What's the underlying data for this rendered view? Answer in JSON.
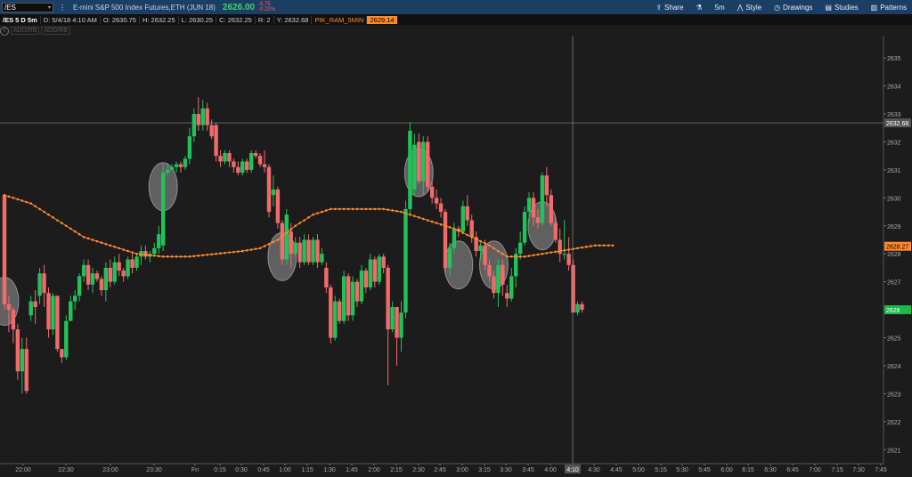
{
  "toolbar": {
    "symbol": "/ES",
    "description": "E-mini S&P 500 Index Futures,ETH (JUN 18)",
    "last_price": "2626.00",
    "net_change": "-5.75",
    "pct_change": "-0.22%",
    "share_label": "Share",
    "style_label": "Style",
    "drawings_label": "Drawings",
    "studies_label": "Studies",
    "patterns_label": "Patterns",
    "interval_icon_label": "5m"
  },
  "infobar": {
    "symbol_period": "/ES 5 D 5m",
    "date": "D: 5/4/18 4:10 AM",
    "open": "O: 2630.75",
    "high": "H: 2632.25",
    "low": "L: 2630.25",
    "close": "C: 2632.25",
    "r": "R: 2",
    "y": "Y: 2632.68",
    "study_name": "PIK_RAM_5MIN",
    "study_value": "2629.14",
    "badge1": "ADD/RB",
    "badge2": "ADD/RB"
  },
  "chart_data": {
    "type": "candlestick",
    "y_axis": {
      "range": [
        2620.5,
        2635.8
      ],
      "tick_labels": [
        "2621",
        "2622",
        "2623",
        "2624",
        "2625",
        "2626",
        "2627",
        "2628",
        "2629",
        "2630",
        "2631",
        "2632",
        "2633",
        "2634",
        "2635"
      ],
      "side": "right"
    },
    "x_axis": {
      "tick_labels": [
        "22:00",
        "22:30",
        "23:00",
        "23:30",
        "Fri",
        "0:15",
        "0:30",
        "0:45",
        "1:00",
        "1:15",
        "1:30",
        "1:45",
        "2:00",
        "2:15",
        "2:30",
        "2:45",
        "3:00",
        "3:15",
        "3:30",
        "3:45",
        "4:00",
        "4:10",
        "4:30",
        "4:45",
        "5:00",
        "5:15",
        "5:30",
        "5:45",
        "6:00",
        "6:15",
        "6:30",
        "6:45",
        "7:00",
        "7:15",
        "7:30",
        "7:45"
      ]
    },
    "candles": [
      [
        2630.1,
        2630.1,
        2626.0,
        2626.2
      ],
      [
        2626.2,
        2626.5,
        2625.2,
        2626.0
      ],
      [
        2626.0,
        2626.1,
        2624.8,
        2625.3
      ],
      [
        2625.3,
        2625.5,
        2623.5,
        2623.8
      ],
      [
        2623.8,
        2625.0,
        2623.0,
        2624.6
      ],
      [
        2624.6,
        2625.0,
        2623.0,
        2623.1
      ],
      [
        2625.8,
        2626.5,
        2625.6,
        2626.3
      ],
      [
        2626.3,
        2626.7,
        2625.5,
        2626.1
      ],
      [
        2626.5,
        2627.5,
        2626.2,
        2627.3
      ],
      [
        2627.3,
        2627.6,
        2626.1,
        2626.6
      ],
      [
        2626.6,
        2626.8,
        2625.0,
        2625.3
      ],
      [
        2625.3,
        2626.6,
        2625.1,
        2626.5
      ],
      [
        2626.5,
        2626.5,
        2624.5,
        2624.6
      ],
      [
        2624.6,
        2624.6,
        2624.1,
        2624.3
      ],
      [
        2624.3,
        2625.8,
        2624.2,
        2625.6
      ],
      [
        2625.6,
        2626.5,
        2625.6,
        2626.3
      ],
      [
        2626.3,
        2626.7,
        2626.0,
        2626.5
      ],
      [
        2626.5,
        2627.3,
        2626.3,
        2627.2
      ],
      [
        2627.2,
        2627.8,
        2627.0,
        2627.6
      ],
      [
        2627.6,
        2627.8,
        2626.7,
        2626.9
      ],
      [
        2626.9,
        2627.5,
        2626.6,
        2627.3
      ],
      [
        2627.3,
        2627.4,
        2627.0,
        2627.1
      ],
      [
        2627.1,
        2627.2,
        2626.5,
        2626.7
      ],
      [
        2626.7,
        2627.7,
        2626.3,
        2627.5
      ],
      [
        2627.5,
        2627.8,
        2626.8,
        2627.0
      ],
      [
        2627.0,
        2627.9,
        2626.9,
        2627.7
      ],
      [
        2627.7,
        2628.0,
        2627.2,
        2627.4
      ],
      [
        2627.4,
        2627.5,
        2627.0,
        2627.2
      ],
      [
        2627.2,
        2627.9,
        2627.1,
        2627.8
      ],
      [
        2627.8,
        2628.0,
        2627.3,
        2627.5
      ],
      [
        2627.5,
        2628.0,
        2627.4,
        2627.9
      ],
      [
        2627.9,
        2628.3,
        2627.6,
        2628.1
      ],
      [
        2628.1,
        2628.3,
        2627.8,
        2627.9
      ],
      [
        2627.9,
        2628.1,
        2627.7,
        2628.0
      ],
      [
        2628.0,
        2628.4,
        2627.9,
        2628.2
      ],
      [
        2628.2,
        2629.0,
        2628.0,
        2628.7
      ],
      [
        2628.3,
        2631.2,
        2628.1,
        2630.9
      ],
      [
        2630.9,
        2631.2,
        2630.8,
        2631.0
      ],
      [
        2631.0,
        2631.2,
        2631.0,
        2631.1
      ],
      [
        2631.1,
        2631.3,
        2630.9,
        2631.2
      ],
      [
        2631.2,
        2631.3,
        2630.9,
        2631.1
      ],
      [
        2631.1,
        2631.5,
        2631.0,
        2631.4
      ],
      [
        2631.4,
        2632.5,
        2631.2,
        2632.2
      ],
      [
        2632.2,
        2633.2,
        2632.0,
        2633.0
      ],
      [
        2633.0,
        2633.6,
        2632.4,
        2632.6
      ],
      [
        2632.6,
        2633.5,
        2632.4,
        2633.2
      ],
      [
        2633.2,
        2633.4,
        2632.4,
        2632.6
      ],
      [
        2632.6,
        2632.8,
        2632.1,
        2632.2
      ],
      [
        2632.6,
        2632.7,
        2631.3,
        2631.5
      ],
      [
        2631.5,
        2631.7,
        2631.1,
        2631.3
      ],
      [
        2631.3,
        2631.7,
        2631.2,
        2631.6
      ],
      [
        2631.6,
        2631.7,
        2631.1,
        2631.3
      ],
      [
        2631.3,
        2631.4,
        2630.9,
        2631.1
      ],
      [
        2631.1,
        2631.3,
        2630.8,
        2630.9
      ],
      [
        2630.9,
        2631.4,
        2630.8,
        2631.3
      ],
      [
        2631.3,
        2631.4,
        2630.9,
        2631.0
      ],
      [
        2631.0,
        2631.7,
        2630.9,
        2631.6
      ],
      [
        2631.6,
        2631.7,
        2631.4,
        2631.5
      ],
      [
        2631.5,
        2631.6,
        2631.1,
        2631.2
      ],
      [
        2631.2,
        2631.7,
        2630.9,
        2631.1
      ],
      [
        2631.1,
        2631.2,
        2629.3,
        2629.5
      ],
      [
        2630.1,
        2630.8,
        2629.7,
        2630.3
      ],
      [
        2630.3,
        2630.4,
        2628.9,
        2629.1
      ],
      [
        2629.1,
        2629.2,
        2627.6,
        2627.8
      ],
      [
        2627.8,
        2629.6,
        2627.6,
        2629.4
      ],
      [
        2628.8,
        2629.1,
        2627.5,
        2628.0
      ],
      [
        2628.0,
        2628.6,
        2627.9,
        2628.4
      ],
      [
        2628.4,
        2628.6,
        2627.5,
        2627.7
      ],
      [
        2627.7,
        2628.7,
        2627.6,
        2628.5
      ],
      [
        2628.5,
        2628.7,
        2627.6,
        2627.7
      ],
      [
        2627.7,
        2628.6,
        2627.6,
        2628.5
      ],
      [
        2628.5,
        2628.7,
        2627.5,
        2627.7
      ],
      [
        2627.7,
        2628.2,
        2627.6,
        2628.0
      ],
      [
        2627.5,
        2627.7,
        2626.6,
        2626.8
      ],
      [
        2626.8,
        2626.9,
        2624.8,
        2625.0
      ],
      [
        2625.0,
        2626.5,
        2624.9,
        2626.3
      ],
      [
        2626.3,
        2626.4,
        2625.5,
        2625.6
      ],
      [
        2625.6,
        2627.4,
        2625.5,
        2627.2
      ],
      [
        2627.2,
        2627.3,
        2625.6,
        2625.8
      ],
      [
        2625.8,
        2627.2,
        2625.6,
        2627.0
      ],
      [
        2627.0,
        2627.1,
        2626.1,
        2626.3
      ],
      [
        2626.3,
        2627.6,
        2626.2,
        2627.4
      ],
      [
        2627.4,
        2627.5,
        2626.6,
        2626.8
      ],
      [
        2626.8,
        2628.0,
        2626.7,
        2627.8
      ],
      [
        2627.8,
        2627.9,
        2626.8,
        2627.0
      ],
      [
        2627.0,
        2628.0,
        2626.9,
        2627.9
      ],
      [
        2627.9,
        2628.0,
        2627.3,
        2627.5
      ],
      [
        2627.5,
        2627.6,
        2623.3,
        2625.3
      ],
      [
        2625.3,
        2626.3,
        2625.2,
        2626.1
      ],
      [
        2626.1,
        2625.8,
        2624.0,
        2625.0
      ],
      [
        2625.0,
        2626.3,
        2624.5,
        2625.9
      ],
      [
        2625.9,
        2629.9,
        2625.7,
        2629.6
      ],
      [
        2629.6,
        2632.7,
        2629.4,
        2632.4
      ],
      [
        2630.3,
        2632.3,
        2630.1,
        2631.9
      ],
      [
        2632.0,
        2632.3,
        2630.5,
        2630.6
      ],
      [
        2630.6,
        2632.2,
        2630.1,
        2632.0
      ],
      [
        2632.0,
        2632.2,
        2630.2,
        2630.4
      ],
      [
        2630.4,
        2630.6,
        2629.8,
        2630.0
      ],
      [
        2630.0,
        2630.3,
        2629.6,
        2629.8
      ],
      [
        2629.8,
        2630.0,
        2629.3,
        2629.5
      ],
      [
        2629.5,
        2629.6,
        2627.3,
        2627.5
      ],
      [
        2627.5,
        2628.4,
        2627.2,
        2628.2
      ],
      [
        2628.2,
        2629.1,
        2628.0,
        2628.9
      ],
      [
        2628.9,
        2629.0,
        2628.6,
        2628.8
      ],
      [
        2628.8,
        2629.9,
        2628.7,
        2629.7
      ],
      [
        2629.7,
        2630.1,
        2629.0,
        2629.2
      ],
      [
        2629.2,
        2629.4,
        2628.4,
        2628.6
      ],
      [
        2628.6,
        2628.8,
        2627.9,
        2628.1
      ],
      [
        2628.1,
        2628.4,
        2627.8,
        2628.3
      ],
      [
        2628.3,
        2628.5,
        2627.4,
        2627.6
      ],
      [
        2627.6,
        2627.8,
        2627.0,
        2627.2
      ],
      [
        2627.2,
        2627.4,
        2626.4,
        2626.6
      ],
      [
        2626.6,
        2627.8,
        2626.1,
        2627.6
      ],
      [
        2627.6,
        2627.8,
        2626.5,
        2626.9
      ],
      [
        2626.6,
        2626.9,
        2626.1,
        2626.4
      ],
      [
        2626.4,
        2627.5,
        2626.3,
        2627.2
      ],
      [
        2627.2,
        2628.2,
        2626.8,
        2628.0
      ],
      [
        2628.0,
        2628.8,
        2627.8,
        2628.4
      ],
      [
        2628.4,
        2629.7,
        2628.3,
        2629.5
      ],
      [
        2629.5,
        2630.2,
        2629.1,
        2630.0
      ],
      [
        2630.0,
        2630.2,
        2629.0,
        2629.3
      ],
      [
        2629.3,
        2629.6,
        2628.9,
        2629.1
      ],
      [
        2629.1,
        2630.9,
        2629.0,
        2630.8
      ],
      [
        2630.8,
        2631.1,
        2629.7,
        2630.1
      ],
      [
        2630.1,
        2630.3,
        2629.0,
        2629.1
      ],
      [
        2629.1,
        2629.3,
        2628.4,
        2628.5
      ],
      [
        2628.5,
        2628.9,
        2627.7,
        2628.0
      ],
      [
        2628.0,
        2629.2,
        2627.8,
        2628.0
      ],
      [
        2628.0,
        2628.6,
        2627.4,
        2627.6
      ],
      [
        2627.6,
        2627.8,
        2625.9,
        2625.9
      ],
      [
        2625.9,
        2626.3,
        2625.8,
        2626.2
      ],
      [
        2626.2,
        2626.3,
        2625.9,
        2626.0
      ]
    ],
    "moving_average": {
      "name": "PIK_RAM_5MIN",
      "color": "#ff8a2a",
      "points": [
        [
          0,
          2630.1
        ],
        [
          6,
          2629.8
        ],
        [
          12,
          2629.2
        ],
        [
          18,
          2628.6
        ],
        [
          24,
          2628.3
        ],
        [
          30,
          2628.0
        ],
        [
          36,
          2627.9
        ],
        [
          42,
          2627.9
        ],
        [
          48,
          2628.0
        ],
        [
          54,
          2628.1
        ],
        [
          58,
          2628.2
        ],
        [
          62,
          2628.5
        ],
        [
          66,
          2629.0
        ],
        [
          70,
          2629.4
        ],
        [
          74,
          2629.6
        ],
        [
          78,
          2629.6
        ],
        [
          82,
          2629.6
        ],
        [
          86,
          2629.6
        ],
        [
          90,
          2629.5
        ],
        [
          94,
          2629.3
        ],
        [
          98,
          2629.1
        ],
        [
          102,
          2628.9
        ],
        [
          106,
          2628.6
        ],
        [
          110,
          2628.3
        ],
        [
          114,
          2627.9
        ],
        [
          118,
          2627.9
        ],
        [
          122,
          2628.0
        ],
        [
          126,
          2628.1
        ],
        [
          130,
          2628.2
        ],
        [
          134,
          2628.3
        ],
        [
          138,
          2628.3
        ]
      ]
    },
    "crosshair": {
      "time_label": "4:10",
      "price_label": "2632.68",
      "price": 2632.68
    },
    "price_tags": [
      {
        "label": "2628.27",
        "price": 2628.27,
        "color": "#ff8a2a"
      },
      {
        "label": "2626",
        "price": 2626.0,
        "color": "#1fb84a"
      }
    ],
    "highlight_ovals": [
      {
        "candle_index": 0,
        "price": 2626.3
      },
      {
        "candle_index": 36,
        "price": 2630.4
      },
      {
        "candle_index": 63,
        "price": 2627.9
      },
      {
        "candle_index": 94,
        "price": 2630.9
      },
      {
        "candle_index": 103,
        "price": 2627.6
      },
      {
        "candle_index": 111,
        "price": 2627.6
      },
      {
        "candle_index": 122,
        "price": 2629.0
      }
    ]
  }
}
